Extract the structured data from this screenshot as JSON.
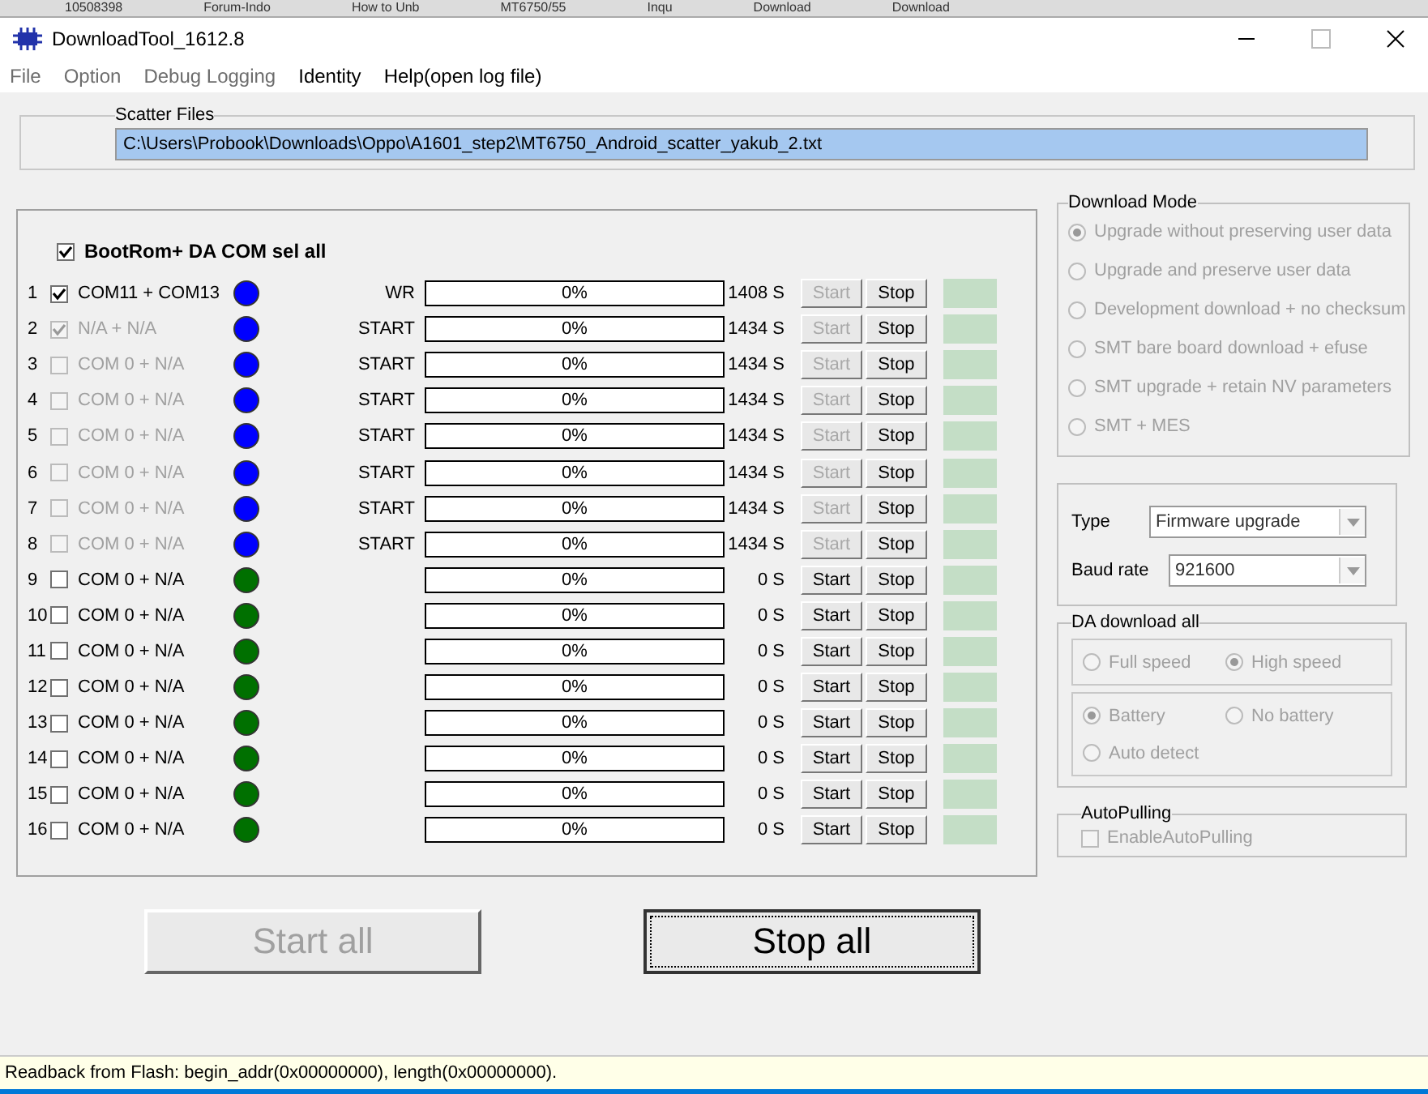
{
  "browser_tabs": [
    "10508398",
    "Forum-Indo",
    "How to Unb",
    "MT6750/55",
    "Inqu",
    "Download",
    "Download"
  ],
  "window": {
    "title": "DownloadTool_1612.8"
  },
  "menu": [
    {
      "label": "File",
      "disabled": true
    },
    {
      "label": "Option",
      "disabled": true
    },
    {
      "label": "Debug Logging",
      "disabled": true
    },
    {
      "label": "Identity",
      "disabled": false
    },
    {
      "label": "Help(open log file)",
      "disabled": false
    }
  ],
  "scatter": {
    "label": "Scatter Files",
    "value": "C:\\Users\\Probook\\Downloads\\Oppo\\A1601_step2\\MT6750_Android_scatter_yakub_2.txt"
  },
  "select_all": {
    "label": "BootRom+ DA COM sel all",
    "checked": true
  },
  "ports": [
    {
      "number": "1",
      "checked": true,
      "disabled": false,
      "label": "COM11 + COM13",
      "color": "#0000ff",
      "status": "WR",
      "progress": "0%",
      "level": 0,
      "time": "1408 S",
      "start_disabled": true,
      "start": "Start",
      "stop": "Stop"
    },
    {
      "number": "2",
      "checked": true,
      "disabled": true,
      "label": "N/A + N/A",
      "color": "#0000ff",
      "status": "START",
      "progress": "0%",
      "level": 0,
      "time": "1434 S",
      "start_disabled": true,
      "start": "Start",
      "stop": "Stop"
    },
    {
      "number": "3",
      "checked": false,
      "disabled": true,
      "label": "COM 0 + N/A",
      "color": "#0000ff",
      "status": "START",
      "progress": "0%",
      "level": 0,
      "time": "1434 S",
      "start_disabled": true,
      "start": "Start",
      "stop": "Stop"
    },
    {
      "number": "4",
      "checked": false,
      "disabled": true,
      "label": "COM 0 + N/A",
      "color": "#0000ff",
      "status": "START",
      "progress": "0%",
      "level": 0,
      "time": "1434 S",
      "start_disabled": true,
      "start": "Start",
      "stop": "Stop"
    },
    {
      "number": "5",
      "checked": false,
      "disabled": true,
      "label": "COM 0 + N/A",
      "color": "#0000ff",
      "status": "START",
      "progress": "0%",
      "level": 0,
      "time": "1434 S",
      "start_disabled": true,
      "start": "Start",
      "stop": "Stop"
    },
    {
      "number": "6",
      "checked": false,
      "disabled": true,
      "label": "COM 0 + N/A",
      "color": "#0000ff",
      "status": "START",
      "progress": "0%",
      "level": 0,
      "time": "1434 S",
      "start_disabled": true,
      "start": "Start",
      "stop": "Stop"
    },
    {
      "number": "7",
      "checked": false,
      "disabled": true,
      "label": "COM 0 + N/A",
      "color": "#0000ff",
      "status": "START",
      "progress": "0%",
      "level": 0,
      "time": "1434 S",
      "start_disabled": true,
      "start": "Start",
      "stop": "Stop"
    },
    {
      "number": "8",
      "checked": false,
      "disabled": true,
      "label": "COM 0 + N/A",
      "color": "#0000ff",
      "status": "START",
      "progress": "0%",
      "level": 0,
      "time": "1434 S",
      "start_disabled": true,
      "start": "Start",
      "stop": "Stop"
    },
    {
      "number": "9",
      "checked": false,
      "disabled": false,
      "label": "COM 0 + N/A",
      "color": "#007000",
      "progress": "0%",
      "level": 0,
      "time": "0 S",
      "start_disabled": false,
      "start": "Start",
      "stop": "Stop"
    },
    {
      "number": "10",
      "checked": false,
      "disabled": false,
      "label": "COM 0 + N/A",
      "color": "#007000",
      "progress": "0%",
      "level": 0,
      "time": "0 S",
      "start_disabled": false,
      "start": "Start",
      "stop": "Stop"
    },
    {
      "number": "11",
      "checked": false,
      "disabled": false,
      "label": "COM 0 + N/A",
      "color": "#007000",
      "progress": "0%",
      "level": 0,
      "time": "0 S",
      "start_disabled": false,
      "start": "Start",
      "stop": "Stop"
    },
    {
      "number": "12",
      "checked": false,
      "disabled": false,
      "label": "COM 0 + N/A",
      "color": "#007000",
      "progress": "0%",
      "level": 0,
      "time": "0 S",
      "start_disabled": false,
      "start": "Start",
      "stop": "Stop"
    },
    {
      "number": "13",
      "checked": false,
      "disabled": false,
      "label": "COM 0 + N/A",
      "color": "#007000",
      "progress": "0%",
      "level": 0,
      "time": "0 S",
      "start_disabled": false,
      "start": "Start",
      "stop": "Stop"
    },
    {
      "number": "14",
      "checked": false,
      "disabled": false,
      "label": "COM 0 + N/A",
      "color": "#007000",
      "progress": "0%",
      "level": 0,
      "time": "0 S",
      "start_disabled": false,
      "start": "Start",
      "stop": "Stop"
    },
    {
      "number": "15",
      "checked": false,
      "disabled": false,
      "label": "COM 0 + N/A",
      "color": "#007000",
      "progress": "0%",
      "level": 0,
      "time": "0 S",
      "start_disabled": false,
      "start": "Start",
      "stop": "Stop"
    },
    {
      "number": "16",
      "checked": false,
      "disabled": false,
      "label": "COM 0 + N/A",
      "color": "#007000",
      "progress": "0%",
      "level": 0,
      "time": "0 S",
      "start_disabled": false,
      "start": "Start",
      "stop": "Stop"
    }
  ],
  "download_mode": {
    "title": "Download Mode",
    "options": [
      {
        "label": "Upgrade without preserving user data",
        "selected": true
      },
      {
        "label": "Upgrade and preserve user data",
        "selected": false
      },
      {
        "label": "Development download + no checksum",
        "selected": false
      },
      {
        "label": "SMT bare board download + efuse",
        "selected": false
      },
      {
        "label": "SMT upgrade + retain NV parameters",
        "selected": false
      },
      {
        "label": "SMT + MES",
        "selected": false
      }
    ]
  },
  "settings": {
    "type_label": "Type",
    "type_value": "Firmware upgrade",
    "baud_label": "Baud rate",
    "baud_value": "921600"
  },
  "da_download": {
    "title": "DA download all",
    "speed": [
      {
        "label": "Full speed",
        "selected": false
      },
      {
        "label": "High speed",
        "selected": true
      }
    ],
    "battery": [
      {
        "label": "Battery",
        "selected": true
      },
      {
        "label": "No battery",
        "selected": false
      },
      {
        "label": "Auto detect",
        "selected": false
      }
    ]
  },
  "auto_pulling": {
    "title": "AutoPulling",
    "label": "EnableAutoPulling",
    "checked": false
  },
  "buttons": [
    {
      "label": "Start all",
      "disabled": true,
      "focused": false
    },
    {
      "label": "Stop all",
      "disabled": false,
      "focused": true
    }
  ],
  "status_bar": "Readback from Flash:  begin_addr(0x00000000), length(0x00000000)."
}
